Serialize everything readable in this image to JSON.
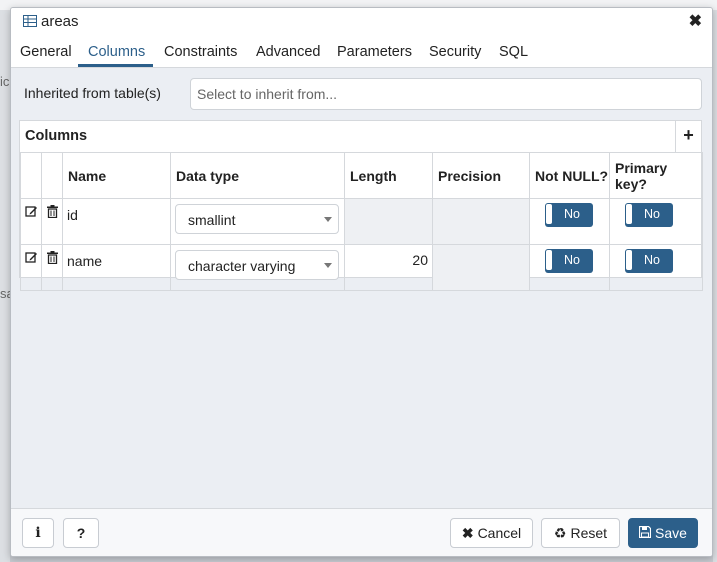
{
  "dialog": {
    "title": "areas"
  },
  "tabs": [
    "General",
    "Columns",
    "Constraints",
    "Advanced",
    "Parameters",
    "Security",
    "SQL"
  ],
  "active_tab": "Columns",
  "inherit": {
    "label": "Inherited from table(s)",
    "placeholder": "Select to inherit from..."
  },
  "grid": {
    "title": "Columns",
    "add_label": "+",
    "headers": [
      "Name",
      "Data type",
      "Length",
      "Precision",
      "Not NULL?",
      "Primary key?"
    ],
    "rows": [
      {
        "name": "id",
        "data_type": "smallint",
        "length": "",
        "precision": "",
        "not_null": "No",
        "primary_key": "No"
      },
      {
        "name": "name",
        "data_type": "character varying",
        "length": "20",
        "precision": "",
        "not_null": "No",
        "primary_key": "No"
      }
    ]
  },
  "footer": {
    "info_label": "i",
    "help_label": "?",
    "cancel_label": "Cancel",
    "reset_label": "Reset",
    "save_label": "Save"
  },
  "colors": {
    "primary": "#2c5f8a",
    "dialog_bg": "#ebeef3"
  },
  "background_fragments": [
    "ic",
    "sa"
  ]
}
